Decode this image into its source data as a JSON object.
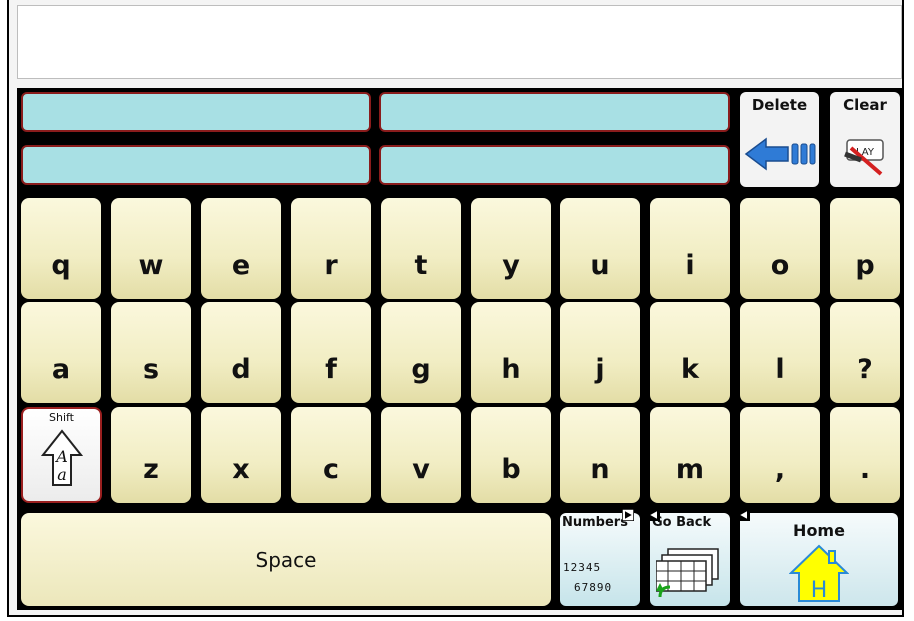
{
  "message_box": {
    "value": ""
  },
  "predictions": [
    "",
    "",
    "",
    ""
  ],
  "commands": {
    "delete": {
      "label": "Delete",
      "icon": "back-arrow-icon"
    },
    "clear": {
      "label": "Clear",
      "icon": "clear-play-icon",
      "icon_text": "LAY"
    }
  },
  "rows": [
    [
      "q",
      "w",
      "e",
      "r",
      "t",
      "y",
      "u",
      "i",
      "o",
      "p"
    ],
    [
      "a",
      "s",
      "d",
      "f",
      "g",
      "h",
      "j",
      "k",
      "l",
      "?"
    ],
    [
      "z",
      "x",
      "c",
      "v",
      "b",
      "n",
      "m",
      ",",
      "."
    ]
  ],
  "shift": {
    "label": "Shift",
    "icon": "shift-arrow-icon",
    "upper": "A",
    "lower": "a"
  },
  "space": {
    "label": "Space"
  },
  "numbers": {
    "label": "Numbers",
    "line1": "12345",
    "line2": "67890"
  },
  "go_back": {
    "label": "Go Back",
    "icon": "keyboard-grid-icon"
  },
  "home": {
    "label": "Home",
    "icon": "house-icon",
    "icon_text": "H"
  },
  "colors": {
    "prediction_fill": "#a8e0e4",
    "prediction_border": "#8a1c1c",
    "key_fill": "#f1edc3",
    "background": "#000000"
  }
}
